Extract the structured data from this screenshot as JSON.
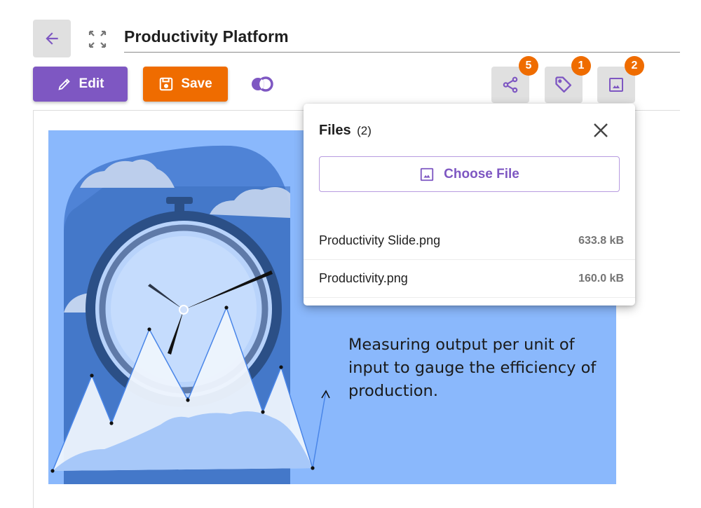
{
  "header": {
    "title": "Productivity Platform",
    "back_icon": "arrow-left-icon",
    "expand_icon": "fullscreen-icon"
  },
  "toolbar": {
    "edit_label": "Edit",
    "edit_icon": "pencil-icon",
    "save_label": "Save",
    "save_icon": "floppy-disk-icon",
    "compare_icon": "compare-circles-icon",
    "share": {
      "icon": "share-icon",
      "badge": "5"
    },
    "tag": {
      "icon": "tag-icon",
      "badge": "1"
    },
    "image": {
      "icon": "image-icon",
      "badge": "2"
    }
  },
  "colors": {
    "primary": "#7e57c2",
    "accent": "#ef6c00",
    "button_grey": "#e0e0e0",
    "slide_bg": "#8ab8fc"
  },
  "slide": {
    "text": "Measuring output per unit of input to gauge the efficiency of production.",
    "illustration": "stopwatch-with-clouds-and-line-chart"
  },
  "files_popup": {
    "title": "Files",
    "count": "(2)",
    "close_icon": "close-icon",
    "choose_file_label": "Choose File",
    "choose_file_icon": "image-icon",
    "files": [
      {
        "name": "Productivity Slide.png",
        "size": "633.8 kB"
      },
      {
        "name": "Productivity.png",
        "size": "160.0 kB"
      }
    ]
  }
}
